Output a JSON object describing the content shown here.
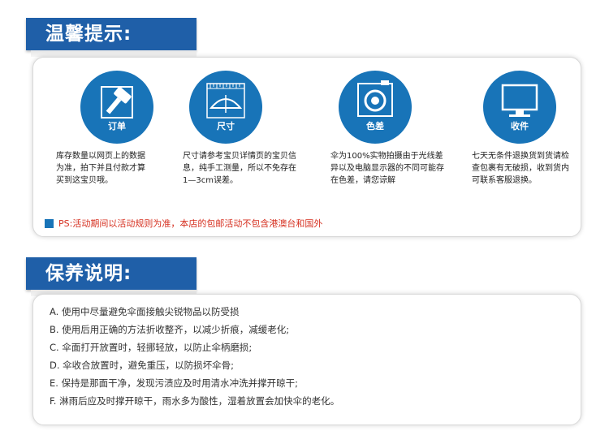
{
  "tips_section": {
    "title": "温馨提示:",
    "items": [
      {
        "label": "订单",
        "icon": "hammer-icon",
        "text": "库存数量以网页上的数据为准，拍下并且付款才算买到这宝贝哦。"
      },
      {
        "label": "尺寸",
        "icon": "umbrella-ruler-icon",
        "text": "尺寸请参考宝贝详情页的宝贝信息，纯手工测量，所以不免存在1—3cm误差。"
      },
      {
        "label": "色差",
        "icon": "camera-icon",
        "text": "伞为100%实物拍摄由于光线差异以及电脑显示器的不同可能存在色差，请您谅解"
      },
      {
        "label": "收件",
        "icon": "monitor-icon",
        "text": "七天无条件退换货到货请检查包裹有无破损，收到货内可联系客服退换。"
      }
    ],
    "ps_note": "PS:活动期间以活动规则为准，本店的包邮活动不包含港澳台和国外"
  },
  "care_section": {
    "title": "保养说明:",
    "items": [
      "A. 使用中尽量避免伞面接触尖锐物品以防受损",
      "B. 使用后用正确的方法折收整齐，以减少折痕，减缓老化;",
      "C. 伞面打开放置时，轻挪轻放，以防止伞柄磨损;",
      "D. 伞收合放置时，避免重压，以防损坏伞骨;",
      "E. 保持是那面干净，发现污渍应及时用清水冲洗并撑开晾干;",
      "F. 淋雨后应及时撑开晾干，雨水多为酸性，湿着放置会加快伞的老化。"
    ]
  },
  "colors": {
    "banner": "#1f5fa8",
    "icon_circle": "#1874b8",
    "ps_text": "#d63020"
  }
}
